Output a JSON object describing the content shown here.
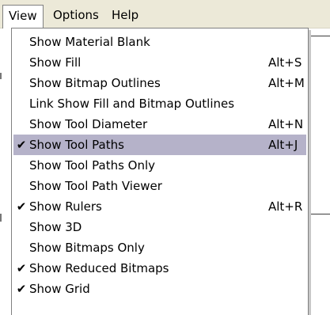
{
  "menubar": {
    "items": [
      {
        "label": "View"
      },
      {
        "label": "Options"
      },
      {
        "label": "Help"
      }
    ]
  },
  "dropdown": {
    "items": [
      {
        "label": "Show Material Blank",
        "shortcut": "",
        "checked": false,
        "highlighted": false
      },
      {
        "label": "Show Fill",
        "shortcut": "Alt+S",
        "checked": false,
        "highlighted": false
      },
      {
        "label": "Show Bitmap Outlines",
        "shortcut": "Alt+M",
        "checked": false,
        "highlighted": false
      },
      {
        "label": "Link Show Fill and Bitmap Outlines",
        "shortcut": "",
        "checked": false,
        "highlighted": false
      },
      {
        "label": "Show Tool Diameter",
        "shortcut": "Alt+N",
        "checked": false,
        "highlighted": false
      },
      {
        "label": "Show Tool Paths",
        "shortcut": "Alt+J",
        "checked": true,
        "highlighted": true
      },
      {
        "label": "Show Tool Paths Only",
        "shortcut": "",
        "checked": false,
        "highlighted": false
      },
      {
        "label": "Show Tool Path Viewer",
        "shortcut": "",
        "checked": false,
        "highlighted": false
      },
      {
        "label": "Show Rulers",
        "shortcut": "Alt+R",
        "checked": true,
        "highlighted": false
      },
      {
        "label": "Show 3D",
        "shortcut": "",
        "checked": false,
        "highlighted": false
      },
      {
        "label": "Show Bitmaps Only",
        "shortcut": "",
        "checked": false,
        "highlighted": false
      },
      {
        "label": "Show Reduced Bitmaps",
        "shortcut": "",
        "checked": true,
        "highlighted": false
      },
      {
        "label": "Show Grid",
        "shortcut": "",
        "checked": true,
        "highlighted": false
      }
    ],
    "check_glyph": "✔"
  },
  "colors": {
    "menubar_bg": "#ece9d8",
    "highlight_bg": "#b5b2c9"
  }
}
